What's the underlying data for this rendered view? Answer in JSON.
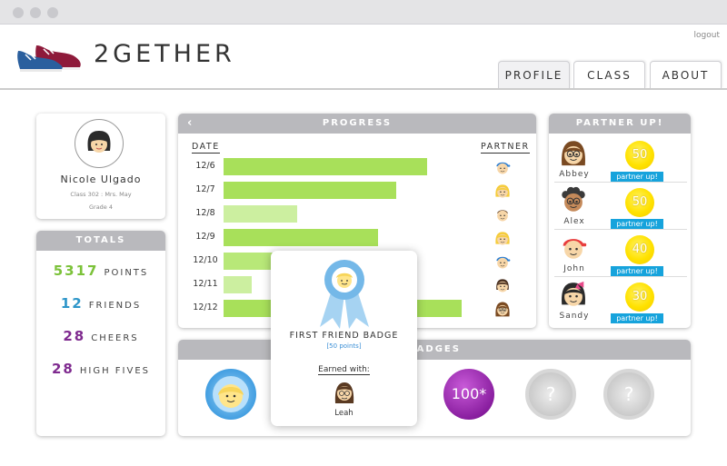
{
  "app": {
    "brand": "2GETHER",
    "logout": "logout"
  },
  "tabs": [
    {
      "label": "PROFILE"
    },
    {
      "label": "CLASS"
    },
    {
      "label": "ABOUT"
    }
  ],
  "profile": {
    "name": "Nicole Ulgado",
    "class_line": "Class 302 : Mrs. May",
    "grade": "Grade 4"
  },
  "totals": {
    "title": "TOTALS",
    "rows": [
      {
        "value": "5317",
        "label": "POINTS",
        "color": "#7cc23a"
      },
      {
        "value": "12",
        "label": "FRIENDS",
        "color": "#2e96c9"
      },
      {
        "value": "28",
        "label": "CHEERS",
        "color": "#7f2a8f"
      },
      {
        "value": "28",
        "label": "HIGH FIVES",
        "color": "#7f2a8f"
      }
    ]
  },
  "progress": {
    "title": "PROGRESS",
    "back_icon": "chevron-left-icon",
    "col_date": "DATE",
    "col_partner": "PARTNER",
    "max_points": 100,
    "rows": [
      {
        "date": "12/6",
        "points": 100,
        "partner": "blue-cap-boy"
      },
      {
        "date": "12/7",
        "points": 85,
        "partner": "blonde-girl"
      },
      {
        "date": "12/8",
        "points": 36,
        "partner": "boy"
      },
      {
        "date": "12/9",
        "points": 76,
        "partner": "blonde-girl"
      },
      {
        "date": "12/10",
        "points": 40,
        "partner": "blue-cap-boy"
      },
      {
        "date": "12/11",
        "points": 14,
        "partner": "pigtails-girl"
      },
      {
        "date": "12/12",
        "points": 117,
        "partner": "glasses-girl"
      }
    ]
  },
  "partner_up": {
    "title": "PARTNER UP!",
    "button_label": "partner up!",
    "partners": [
      {
        "name": "Abbey",
        "points": "50",
        "avatar": "glasses-girl"
      },
      {
        "name": "Alex",
        "points": "50",
        "avatar": "curly-glasses-boy"
      },
      {
        "name": "John",
        "points": "40",
        "avatar": "red-cap-boy"
      },
      {
        "name": "Sandy",
        "points": "30",
        "avatar": "pink-bow-girl"
      }
    ]
  },
  "badges": {
    "title": "BADGES",
    "items": [
      {
        "kind": "first-friend",
        "label": ""
      },
      {
        "kind": "100",
        "label": "100*"
      },
      {
        "kind": "locked",
        "label": "?"
      },
      {
        "kind": "locked",
        "label": "?"
      }
    ]
  },
  "popup": {
    "title": "FIRST FRIEND BADGE",
    "points": "[50 points]",
    "earned_label": "Earned with:",
    "partner": "Leah"
  }
}
